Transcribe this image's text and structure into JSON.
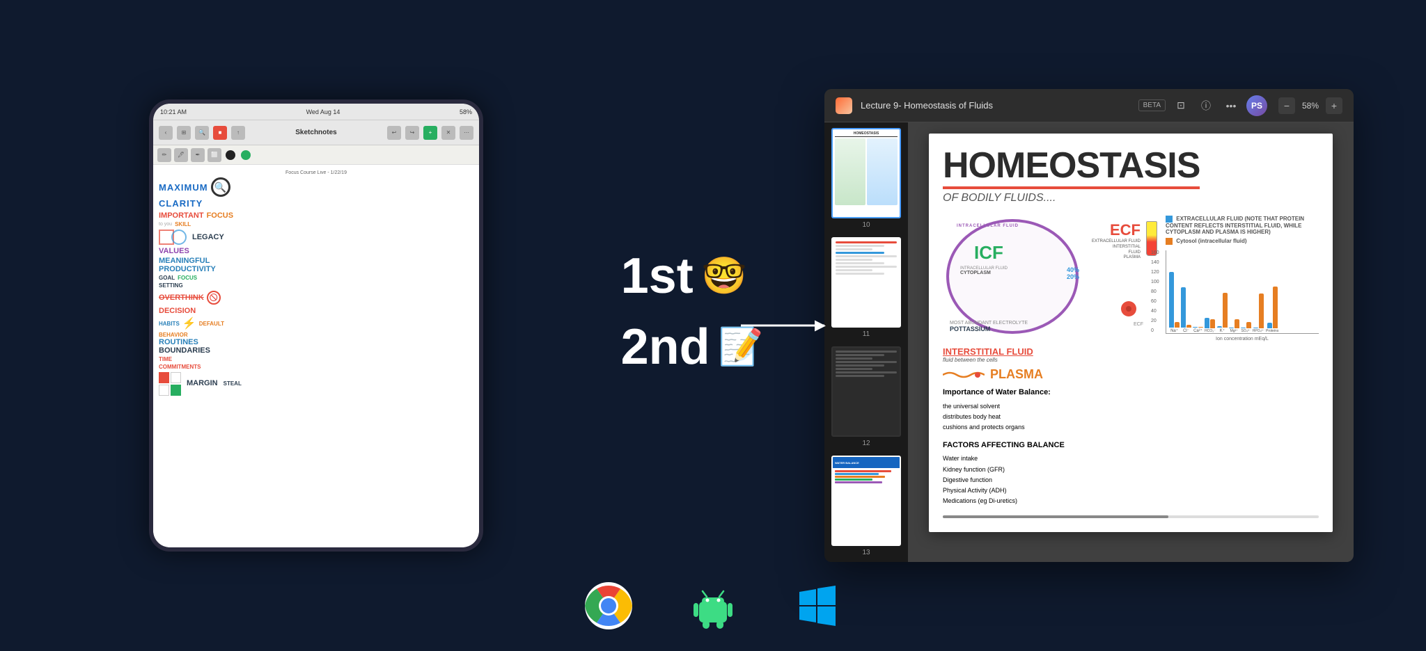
{
  "app": {
    "background": "#0f1a2e"
  },
  "ipad": {
    "statusbar": {
      "time": "10:21 AM",
      "date": "Wed Aug 14",
      "battery": "58%"
    },
    "toolbar": {
      "title": "Sketchnotes"
    },
    "sketchnotes": {
      "header": "Focus Course Live - 1/22/19",
      "words": [
        {
          "text": "MAXIMUM",
          "style": "blue huge"
        },
        {
          "text": "CLARITY",
          "style": "blue huge"
        },
        {
          "text": "IMPORTANT",
          "style": "red big"
        },
        {
          "text": "FOCUS",
          "style": "orange big"
        },
        {
          "text": "SKILL",
          "style": "orange"
        },
        {
          "text": "LEGACY",
          "style": "dark big"
        },
        {
          "text": "VALUES",
          "style": "purple big"
        },
        {
          "text": "MEANINGFUL",
          "style": "blue big"
        },
        {
          "text": "PRODUCTIVITY",
          "style": "blue big"
        },
        {
          "text": "FOCUS",
          "style": "green"
        },
        {
          "text": "GOAL",
          "style": "dark"
        },
        {
          "text": "SETTING",
          "style": "dark"
        },
        {
          "text": "OVERTHINK",
          "style": "red big"
        },
        {
          "text": "DECISION",
          "style": "red big"
        },
        {
          "text": "HABITS",
          "style": "blue"
        },
        {
          "text": "DEFAULT",
          "style": "orange"
        },
        {
          "text": "BEHAVIOR",
          "style": "orange"
        },
        {
          "text": "ROUTINES",
          "style": "blue big"
        },
        {
          "text": "BOUNDARIES",
          "style": "dark big"
        },
        {
          "text": "TIME",
          "style": "red"
        },
        {
          "text": "COMMITMENTS",
          "style": "red"
        },
        {
          "text": "MARGIN",
          "style": "dark big"
        },
        {
          "text": "STEAL",
          "style": "dark"
        }
      ]
    }
  },
  "middle": {
    "step1": {
      "text": "1st",
      "emoji": "🤓"
    },
    "step2": {
      "text": "2nd",
      "emoji": "📝"
    },
    "arrow": "→"
  },
  "pdf_reader": {
    "title": "Lecture 9- Homeostasis of Fluids",
    "beta_badge": "BETA",
    "zoom_level": "58%",
    "avatar_initials": "PS",
    "thumbnails": [
      {
        "num": "10",
        "type": "homeostasis",
        "active": true
      },
      {
        "num": "11",
        "type": "text"
      },
      {
        "num": "12",
        "type": "text_dark"
      },
      {
        "num": "13",
        "type": "water_balance"
      },
      {
        "num": "",
        "type": "electrolytes"
      }
    ],
    "page_content": {
      "main_title": "HOMEOSTASIS",
      "subtitle": "OF BODILY FLUIDS....",
      "icf_label": "ICF",
      "icf_full": "INTRACELLULAR FLUID",
      "ecf_label": "ECF",
      "ecf_full": "EXTRACELLULAR FLUID",
      "cytoplasm": "CYTOPLASM",
      "pottassium": "POTTASSIUM",
      "interstitial": "INTERSTITIAL FLUID",
      "interstitial_sub": "fluid between the cells",
      "plasma": "PLASMA",
      "importance_title": "Importance of Water Balance:",
      "importance_points": [
        "the universal solvent",
        "distributes body heat",
        "cushions and protects organs"
      ],
      "factors_title": "FACTORS AFFECTING BALANCE",
      "factors": [
        "Water intake",
        "Kidney function (GFR)",
        "Digestive function",
        "Physical Activity (ADH)",
        "Medications (eg Di-uretics)"
      ],
      "icf_percent": "40%",
      "ecf_percent": "20%",
      "plasma_percent": "40%"
    }
  },
  "platforms": [
    {
      "name": "Chrome",
      "icon_type": "chrome"
    },
    {
      "name": "Android",
      "icon_type": "android"
    },
    {
      "name": "Windows",
      "icon_type": "windows"
    }
  ]
}
